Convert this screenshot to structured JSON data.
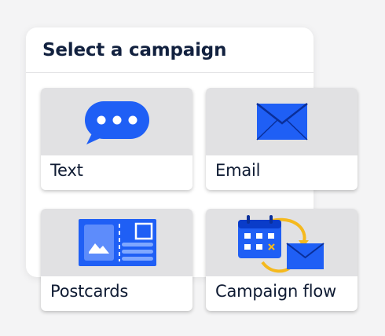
{
  "panel": {
    "title": "Select a campaign"
  },
  "campaigns": [
    {
      "label": "Text",
      "icon": "chat-bubble-icon"
    },
    {
      "label": "Email",
      "icon": "envelope-icon"
    },
    {
      "label": "Postcards",
      "icon": "postcard-icon"
    },
    {
      "label": "Campaign flow",
      "icon": "campaign-flow-icon"
    }
  ],
  "colors": {
    "primary_blue": "#1f5ff5",
    "accent_yellow": "#f5b91e",
    "card_media_bg": "#e1e1e3",
    "title_text": "#12213f"
  }
}
